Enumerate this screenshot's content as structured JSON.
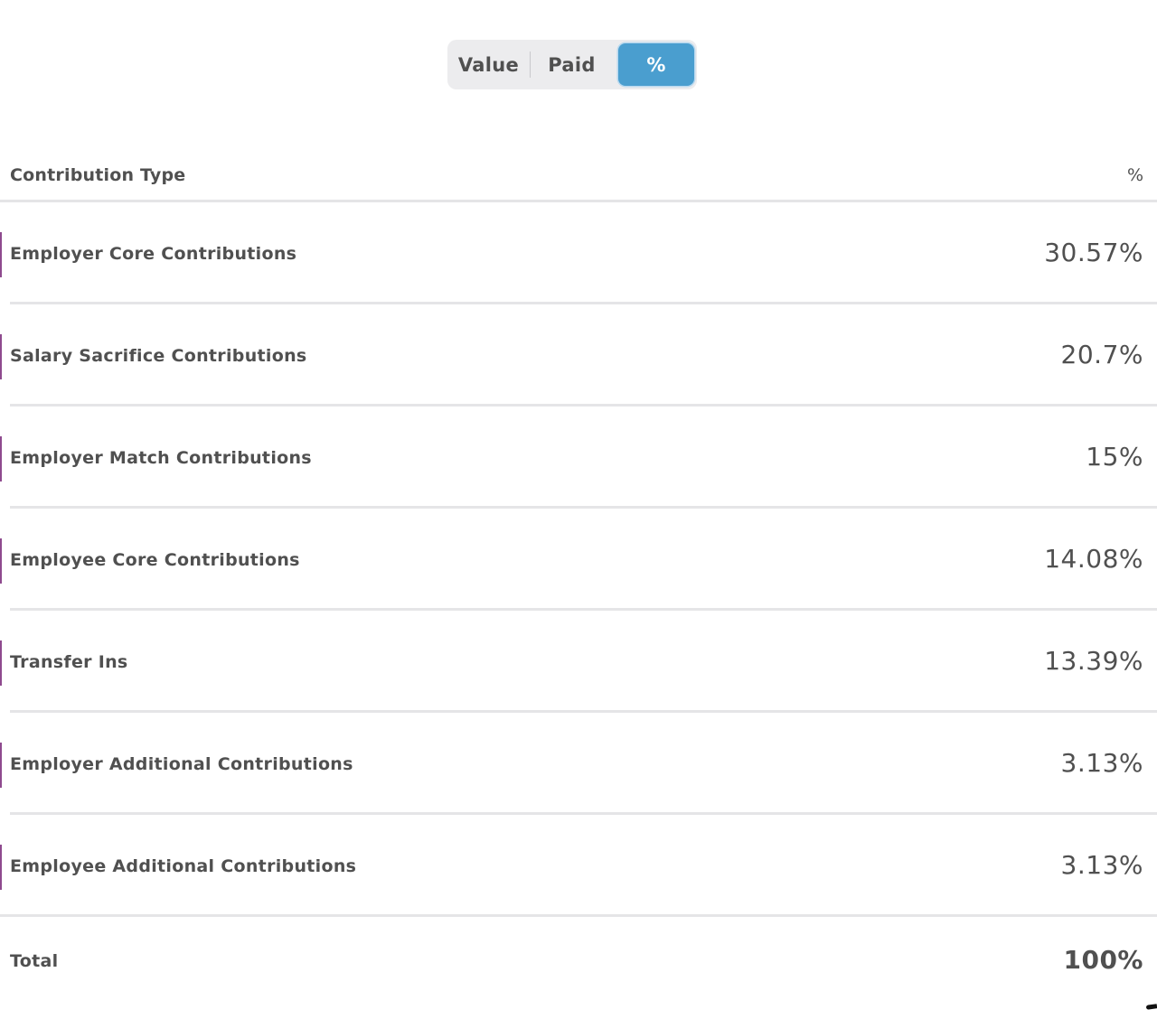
{
  "segmented": {
    "options": [
      "Value",
      "Paid",
      "%"
    ],
    "selected": "%"
  },
  "table": {
    "headers": {
      "type": "Contribution Type",
      "pct": "%"
    },
    "rows": [
      {
        "label": "Employer Core Contributions",
        "value": "30.57%"
      },
      {
        "label": "Salary Sacrifice Contributions",
        "value": "20.7%"
      },
      {
        "label": "Employer Match Contributions",
        "value": "15%"
      },
      {
        "label": "Employee Core Contributions",
        "value": "14.08%"
      },
      {
        "label": "Transfer Ins",
        "value": "13.39%"
      },
      {
        "label": "Employer Additional Contributions",
        "value": "3.13%"
      },
      {
        "label": "Employee Additional Contributions",
        "value": "3.13%"
      }
    ],
    "total": {
      "label": "Total",
      "value": "100%"
    }
  },
  "colors": {
    "accent": "#4a9ecf",
    "marker": "#8e4a8e",
    "text": "#505050",
    "divider": "#e5e5e7"
  }
}
